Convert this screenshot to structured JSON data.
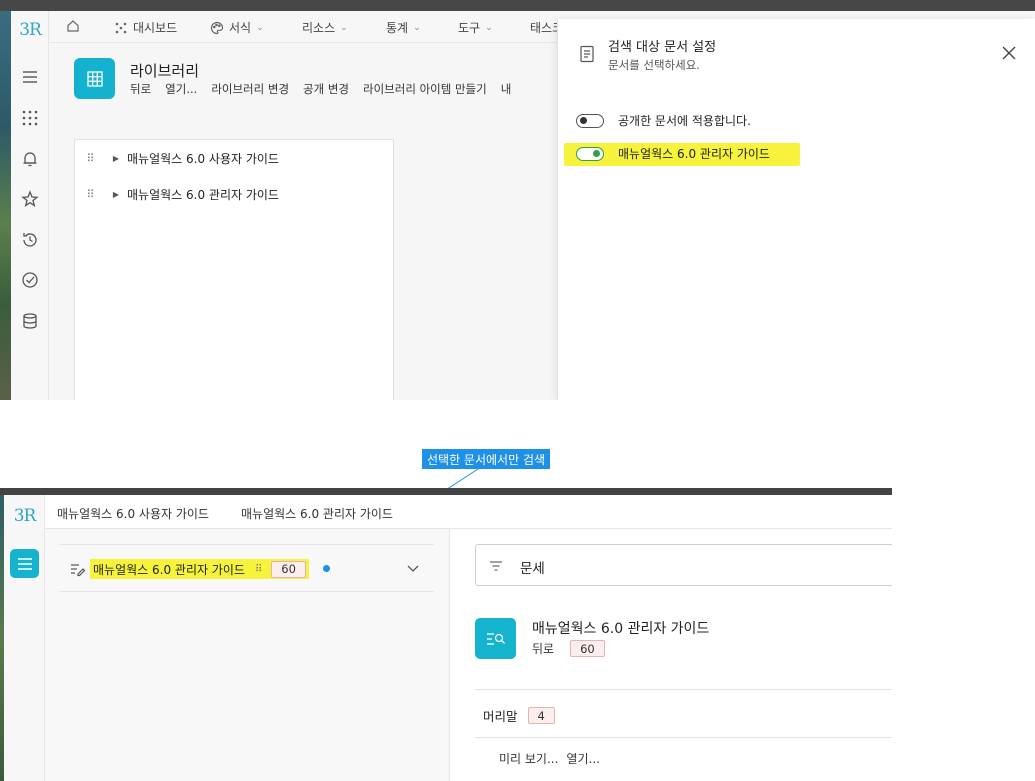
{
  "top": {
    "rail": {
      "logo": "3R",
      "icons": [
        "hamburger-icon",
        "grid-dots-icon",
        "bell-icon",
        "star-icon",
        "history-icon",
        "check-circle-icon",
        "database-icon"
      ]
    },
    "nav": {
      "items": [
        {
          "label": "대시보드",
          "icon": "dashboard-icon",
          "chevron": false
        },
        {
          "label": "서식",
          "icon": "palette-icon",
          "chevron": true
        },
        {
          "label": "리소스",
          "chevron": true
        },
        {
          "label": "통계",
          "chevron": true
        },
        {
          "label": "도구",
          "chevron": true
        },
        {
          "label": "태스크",
          "chevron": false
        }
      ]
    },
    "library": {
      "title": "라이브러리",
      "actions": [
        "뒤로",
        "열기...",
        "라이브러리 변경",
        "공개 변경",
        "라이브러리 아이템 만들기",
        "내"
      ]
    },
    "tree": [
      {
        "label": "매뉴얼웍스 6.0 사용자 가이드"
      },
      {
        "label": "매뉴얼웍스 6.0 관리자 가이드"
      }
    ],
    "drawer": {
      "title": "검색 대상 문서 설정",
      "subtitle": "문서를 선택하세요.",
      "toggles": [
        {
          "label": "공개한 문서에 적용합니다.",
          "on": false
        },
        {
          "label": "매뉴얼웍스 6.0 관리자 가이드",
          "on": true
        }
      ]
    }
  },
  "callout": {
    "label": "선택한 문서에서만 검색",
    "color": "#1e90e6"
  },
  "bottom": {
    "rail": {
      "logo": "3R"
    },
    "tabs": [
      "매뉴얼웍스 6.0 사용자 가이드",
      "매뉴얼웍스 6.0 관리자 가이드"
    ],
    "selected_doc": {
      "label": "매뉴얼웍스 6.0 관리자 가이드",
      "count": "60"
    },
    "search": {
      "value": "문세"
    },
    "result": {
      "title": "매뉴얼웍스 6.0 관리자 가이드",
      "back": "뒤로",
      "count": "60"
    },
    "section": {
      "label": "머리말",
      "count": "4"
    },
    "actions": [
      "미리 보기...",
      "열기..."
    ]
  },
  "colors": {
    "accent": "#16b3cf",
    "highlight": "#f7f23b",
    "toggle_on": "#2f9e4f"
  }
}
